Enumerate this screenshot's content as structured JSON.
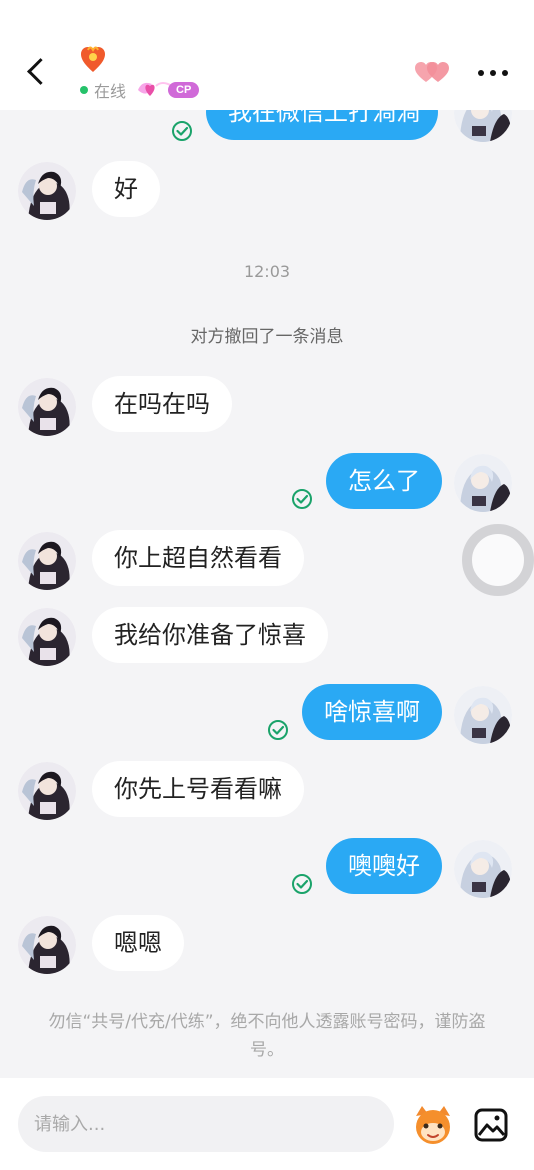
{
  "header": {
    "status": "在线",
    "cp_badge": "CP",
    "icons": [
      "back-icon",
      "heart-avatar-icon",
      "cp-wing-icon",
      "couple-hearts-icon",
      "more-icon"
    ]
  },
  "messages": [
    {
      "side": "right",
      "text": "我在微信上打渦渦",
      "partial": true
    },
    {
      "side": "left",
      "text": "好"
    },
    {
      "side": "left",
      "text": "在吗在吗"
    },
    {
      "side": "right",
      "text": "怎么了"
    },
    {
      "side": "left",
      "text": "你上超自然看看"
    },
    {
      "side": "left",
      "text": "我给你准备了惊喜"
    },
    {
      "side": "right",
      "text": "啥惊喜啊"
    },
    {
      "side": "left",
      "text": "你先上号看看嘛"
    },
    {
      "side": "right",
      "text": "噢噢好"
    },
    {
      "side": "left",
      "text": "嗯嗯"
    }
  ],
  "timestamp": "12:03",
  "system_notice": "对方撤回了一条消息",
  "warning": "勿信“共号/代充/代练”，绝不向他人透露账号密码，谨防盗号。",
  "input": {
    "placeholder": "请输入..."
  },
  "colors": {
    "accent_blue": "#2aa9f4",
    "online_green": "#25c26a",
    "check_green": "#1aa36a"
  }
}
